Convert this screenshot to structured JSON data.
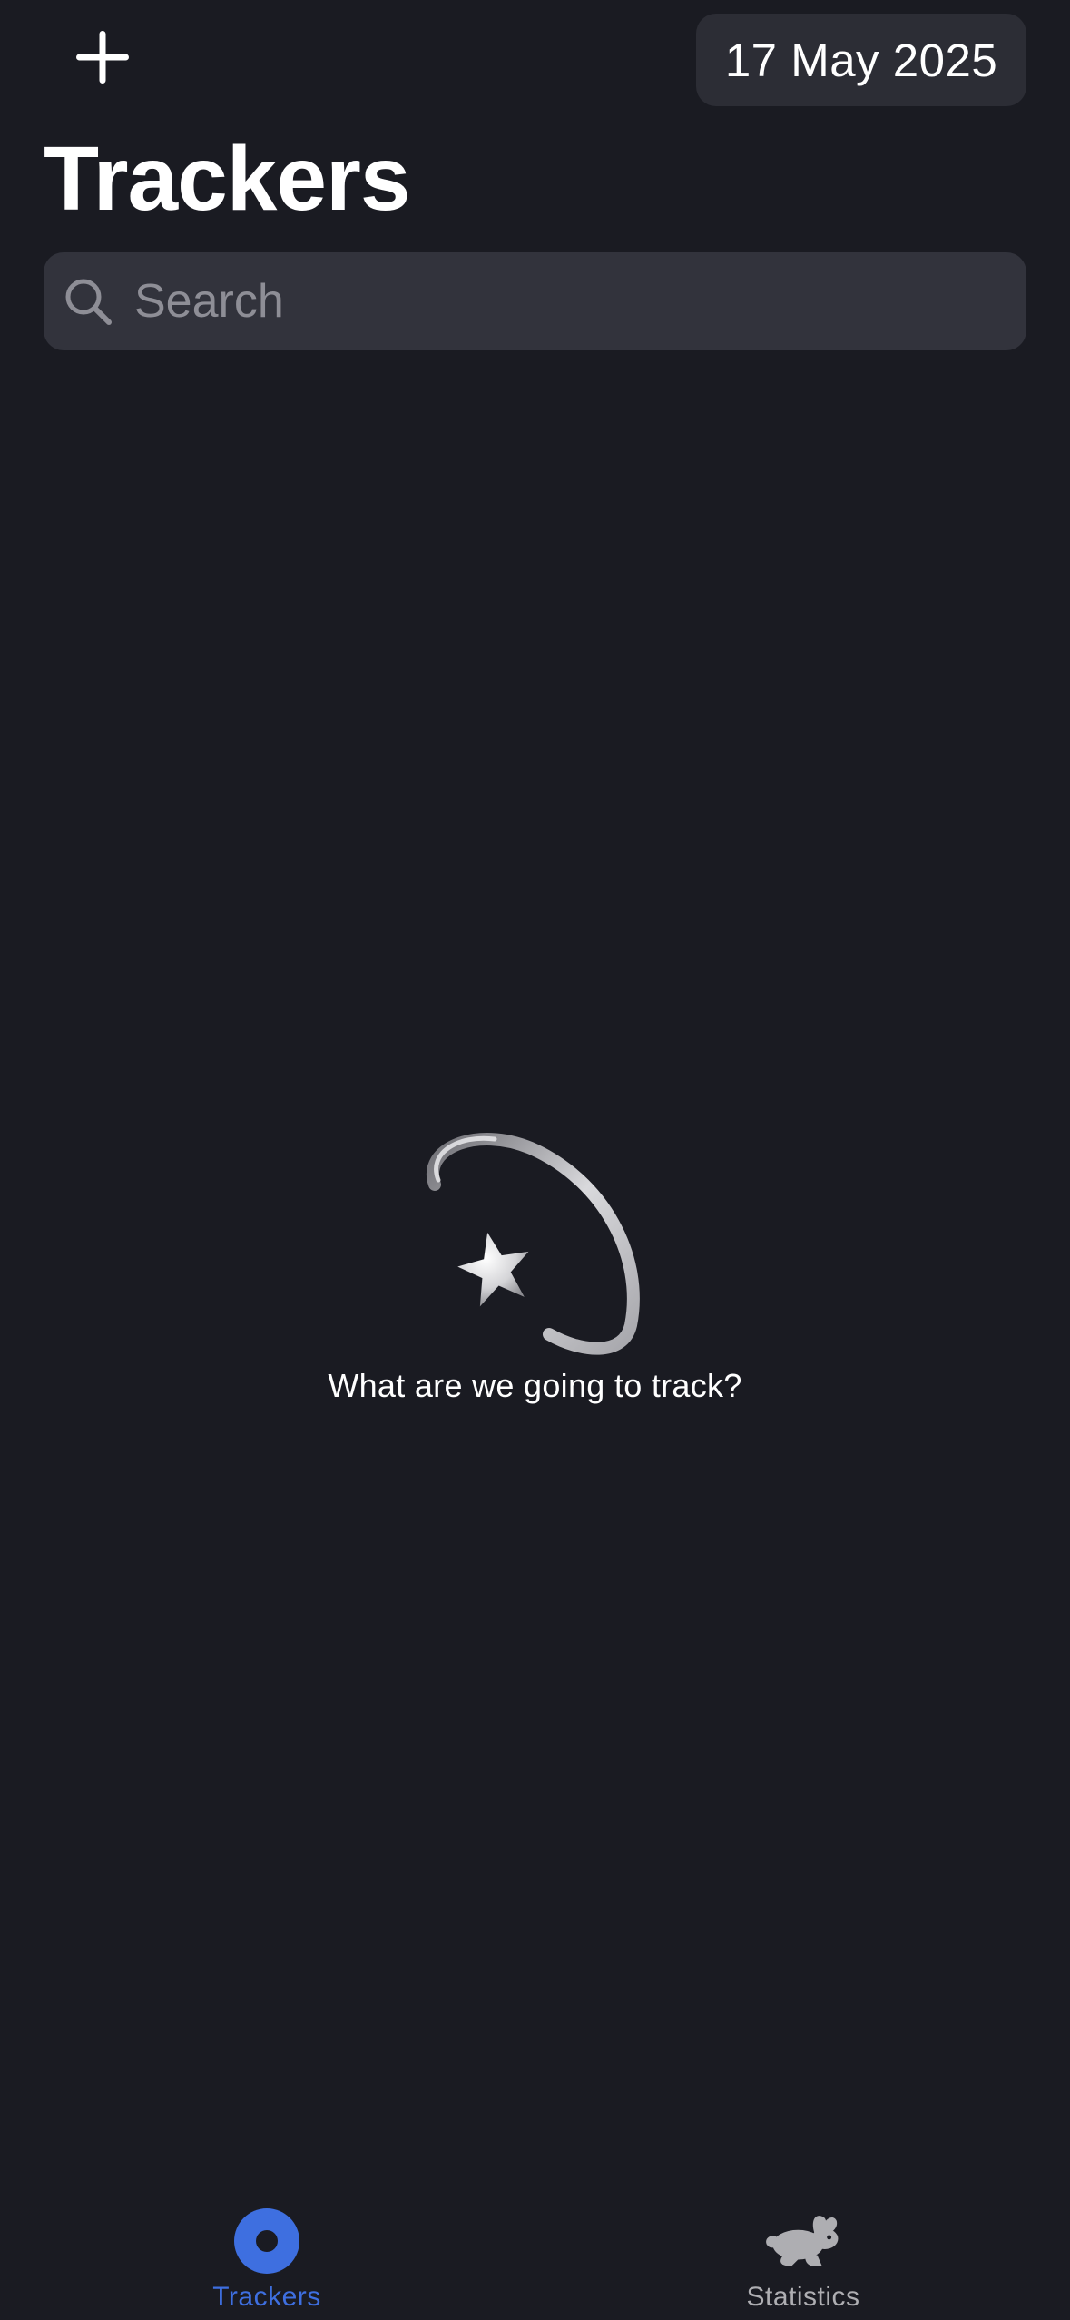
{
  "header": {
    "add_icon": "plus-icon",
    "date_label": "17 May 2025"
  },
  "page_title": "Trackers",
  "search": {
    "placeholder": "Search",
    "value": "",
    "icon": "magnifying-glass-icon"
  },
  "empty_state": {
    "illustration": "dizzy-star-icon",
    "message": "What are we going to track?"
  },
  "tab_bar": {
    "tabs": [
      {
        "label": "Trackers",
        "icon": "record-circle-icon",
        "selected": true
      },
      {
        "label": "Statistics",
        "icon": "hare-icon",
        "selected": false
      }
    ]
  },
  "colors": {
    "background": "#1a1b22",
    "surface": "#2c2d35",
    "search_background": "#32333c",
    "accent": "#3e6fe0",
    "inactive": "#aeaeb2",
    "placeholder": "#8e8e96",
    "text": "#ffffff"
  }
}
